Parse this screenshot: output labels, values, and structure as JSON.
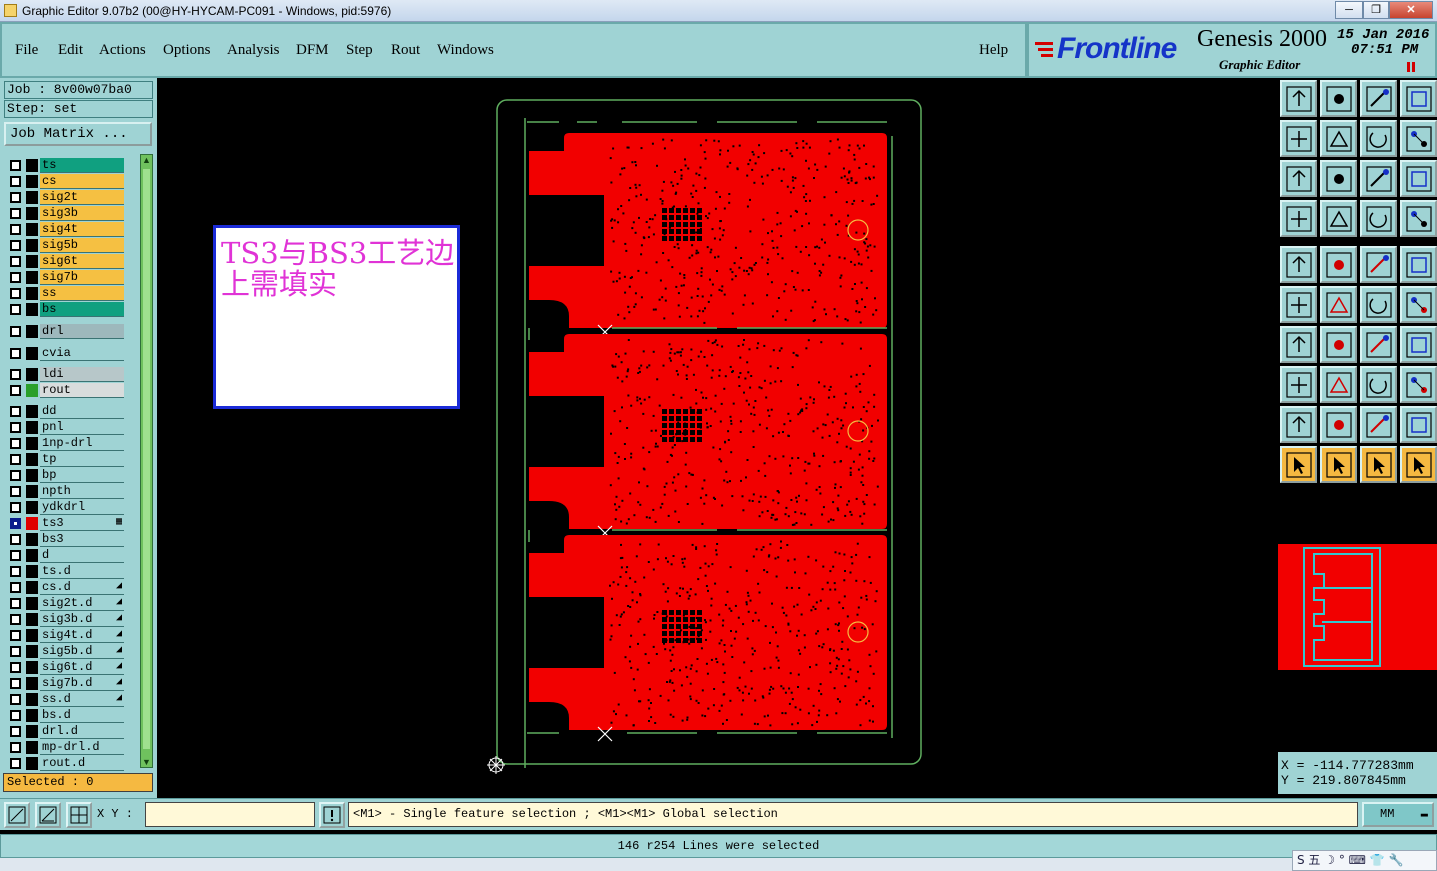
{
  "window": {
    "title": "Graphic Editor 9.07b2 (00@HY-HYCAM-PC091 - Windows, pid:5976)",
    "min_label": "─",
    "max_label": "❐",
    "close_label": "✕"
  },
  "menu": [
    {
      "label": "File"
    },
    {
      "label": "Edit"
    },
    {
      "label": "Actions"
    },
    {
      "label": "Options"
    },
    {
      "label": "Analysis"
    },
    {
      "label": "DFM"
    },
    {
      "label": "Step"
    },
    {
      "label": "Rout"
    },
    {
      "label": "Windows"
    },
    {
      "label": "Help"
    }
  ],
  "brand": {
    "logo_text": "Frontline",
    "product": "Genesis 2000",
    "subtitle": "Graphic Editor",
    "date": "15 Jan 2016",
    "time": "07:51 PM"
  },
  "job": {
    "job_label": "Job : 8v00w07ba0",
    "step_label": "Step: set",
    "matrix_button": "Job Matrix ..."
  },
  "layers": [
    {
      "name": "ts",
      "color": "#10a080",
      "checked": false,
      "swatch": "#000000"
    },
    {
      "name": "cs",
      "color": "#f5c042",
      "checked": false,
      "swatch": "#000000"
    },
    {
      "name": "sig2t",
      "color": "#f5c042",
      "checked": false,
      "swatch": "#000000"
    },
    {
      "name": "sig3b",
      "color": "#f5c042",
      "checked": false,
      "swatch": "#000000"
    },
    {
      "name": "sig4t",
      "color": "#f5c042",
      "checked": false,
      "swatch": "#000000"
    },
    {
      "name": "sig5b",
      "color": "#f5c042",
      "checked": false,
      "swatch": "#000000"
    },
    {
      "name": "sig6t",
      "color": "#f5c042",
      "checked": false,
      "swatch": "#000000"
    },
    {
      "name": "sig7b",
      "color": "#f5c042",
      "checked": false,
      "swatch": "#000000"
    },
    {
      "name": "ss",
      "color": "#f5c042",
      "checked": false,
      "swatch": "#000000"
    },
    {
      "name": "bs",
      "color": "#10a080",
      "checked": false,
      "swatch": "#000000"
    },
    {
      "name": "drl",
      "color": "#9db8bc",
      "checked": false,
      "swatch": "#000000"
    },
    {
      "name": "cvia",
      "color": "#9fd3d4",
      "checked": false,
      "swatch": "#000000"
    },
    {
      "name": "ldi",
      "color": "#b7c7c9",
      "checked": false,
      "swatch": "#000000"
    },
    {
      "name": "rout",
      "color": "#d8dcdc",
      "checked": false,
      "swatch": "#2aa02a"
    },
    {
      "name": "dd",
      "color": "#9fd3d4",
      "checked": false,
      "swatch": "#000000"
    },
    {
      "name": "pnl",
      "color": "#9fd3d4",
      "checked": false,
      "swatch": "#000000"
    },
    {
      "name": "1np-drl",
      "color": "#9fd3d4",
      "checked": false,
      "swatch": "#000000"
    },
    {
      "name": "tp",
      "color": "#9fd3d4",
      "checked": false,
      "swatch": "#000000"
    },
    {
      "name": "bp",
      "color": "#9fd3d4",
      "checked": false,
      "swatch": "#000000"
    },
    {
      "name": "npth",
      "color": "#9fd3d4",
      "checked": false,
      "swatch": "#000000"
    },
    {
      "name": "ydkdrl",
      "color": "#9fd3d4",
      "checked": false,
      "swatch": "#000000"
    },
    {
      "name": "ts3",
      "color": "#9fd3d4",
      "checked": true,
      "swatch": "#e00000",
      "mark": "▦"
    },
    {
      "name": "bs3",
      "color": "#9fd3d4",
      "checked": false,
      "swatch": "#000000"
    },
    {
      "name": "d",
      "color": "#9fd3d4",
      "checked": false,
      "swatch": "#000000"
    },
    {
      "name": "ts.d",
      "color": "#9fd3d4",
      "checked": false,
      "swatch": "#000000"
    },
    {
      "name": "cs.d",
      "color": "#9fd3d4",
      "checked": false,
      "swatch": "#000000",
      "mark": "◢"
    },
    {
      "name": "sig2t.d",
      "color": "#9fd3d4",
      "checked": false,
      "swatch": "#000000",
      "mark": "◢"
    },
    {
      "name": "sig3b.d",
      "color": "#9fd3d4",
      "checked": false,
      "swatch": "#000000",
      "mark": "◢"
    },
    {
      "name": "sig4t.d",
      "color": "#9fd3d4",
      "checked": false,
      "swatch": "#000000",
      "mark": "◢"
    },
    {
      "name": "sig5b.d",
      "color": "#9fd3d4",
      "checked": false,
      "swatch": "#000000",
      "mark": "◢"
    },
    {
      "name": "sig6t.d",
      "color": "#9fd3d4",
      "checked": false,
      "swatch": "#000000",
      "mark": "◢"
    },
    {
      "name": "sig7b.d",
      "color": "#9fd3d4",
      "checked": false,
      "swatch": "#000000",
      "mark": "◢"
    },
    {
      "name": "ss.d",
      "color": "#9fd3d4",
      "checked": false,
      "swatch": "#000000",
      "mark": "◢"
    },
    {
      "name": "bs.d",
      "color": "#9fd3d4",
      "checked": false,
      "swatch": "#000000"
    },
    {
      "name": "drl.d",
      "color": "#9fd3d4",
      "checked": false,
      "swatch": "#000000"
    },
    {
      "name": "mp-drl.d",
      "color": "#9fd3d4",
      "checked": false,
      "swatch": "#000000"
    },
    {
      "name": "rout.d",
      "color": "#9fd3d4",
      "checked": false,
      "swatch": "#000000"
    }
  ],
  "selected_label": "Selected : 0",
  "annotation": {
    "text": "TS3与BS3工艺边上需填实",
    "text_color": "#e033d6",
    "border_color": "#1b2bd8"
  },
  "colors": {
    "copper": "#f20000",
    "outline": "#5fae5f",
    "panel_bg": "#9fd3d4",
    "highlight": "#f5b941"
  },
  "coords": {
    "x": "X = -114.777283mm",
    "y": "Y = 219.807845mm"
  },
  "bottom": {
    "xy_label": "X Y :",
    "xy_value": "",
    "help_text": "<M1> - Single feature selection ; <M1><M1> Global selection",
    "units": "MM",
    "status": "146 r254 Lines were selected"
  },
  "ime": {
    "text": "S 五 ☽ ° ⌨ 👕 🔧"
  },
  "tools": [
    "panel-up-icon",
    "panel-down-icon",
    "home-icon",
    "window-icon",
    "step-in-icon",
    "step-out-icon",
    "mirror-icon",
    "snap-icon",
    "zoom-fit-icon",
    "zoom-home-icon",
    "scale-icon",
    "help-icon",
    "measure-icon",
    "pin-icon",
    "layer-compare-icon",
    "layer-toggle-icon",
    "select-icon",
    "resize-icon",
    "ruler-icon",
    "dot-icon",
    "connect-icon",
    "cross-icon",
    "move-icon",
    "copy-icon",
    "angle-icon",
    "line-icon",
    "rotate-icon",
    "flip-icon",
    "nodes-icon",
    "minus-icon",
    "center-icon",
    "shapes-icon",
    "triangle-icon",
    "arc-icon",
    "arrow-arc-icon",
    "bridge-icon",
    "pointer-icon",
    "pointer-box-icon",
    "pointer-circle-icon",
    "pointer-path-icon"
  ]
}
